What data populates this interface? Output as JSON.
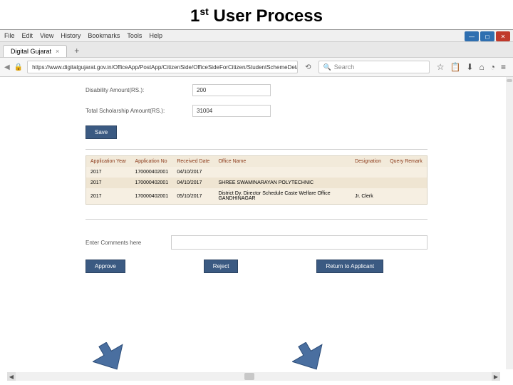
{
  "slide": {
    "title_pre": "1",
    "title_sup": "st",
    "title_post": " User Process"
  },
  "menubar": [
    "File",
    "Edit",
    "View",
    "History",
    "Bookmarks",
    "Tools",
    "Help"
  ],
  "tab": {
    "title": "Digital Gujarat"
  },
  "address": {
    "url": "https://www.digitalgujarat.gov.in/OfficeApp/PostApp/CitizenSide/OfficeSideForCitizen/StudentSchemeDetailEntry-SC.aspx"
  },
  "search": {
    "placeholder": "Search"
  },
  "form": {
    "disability_label": "Disability Amount(RS.):",
    "disability_value": "200",
    "total_label": "Total Scholarship Amount(RS.):",
    "total_value": "31004",
    "save_label": "Save"
  },
  "table": {
    "headers": [
      "Application Year",
      "Application No",
      "Received Date",
      "Office Name",
      "Designation",
      "Query Remark"
    ],
    "rows": [
      {
        "year": "2017",
        "appno": "170000402001",
        "date": "04/10/2017",
        "office": "",
        "desig": "",
        "remark": ""
      },
      {
        "year": "2017",
        "appno": "170000402001",
        "date": "04/10/2017",
        "office": "SHREE SWAMINARAYAN POLYTECHNIC",
        "desig": "",
        "remark": ""
      },
      {
        "year": "2017",
        "appno": "170000402001",
        "date": "05/10/2017",
        "office": "District Dy. Director Schedule Caste Welfare Office GANDHINAGAR",
        "desig": "Jr. Clerk",
        "remark": ""
      }
    ]
  },
  "comments": {
    "label": "Enter Comments here"
  },
  "actions": {
    "approve": "Approve",
    "reject": "Reject",
    "return": "Return to Applicant"
  }
}
